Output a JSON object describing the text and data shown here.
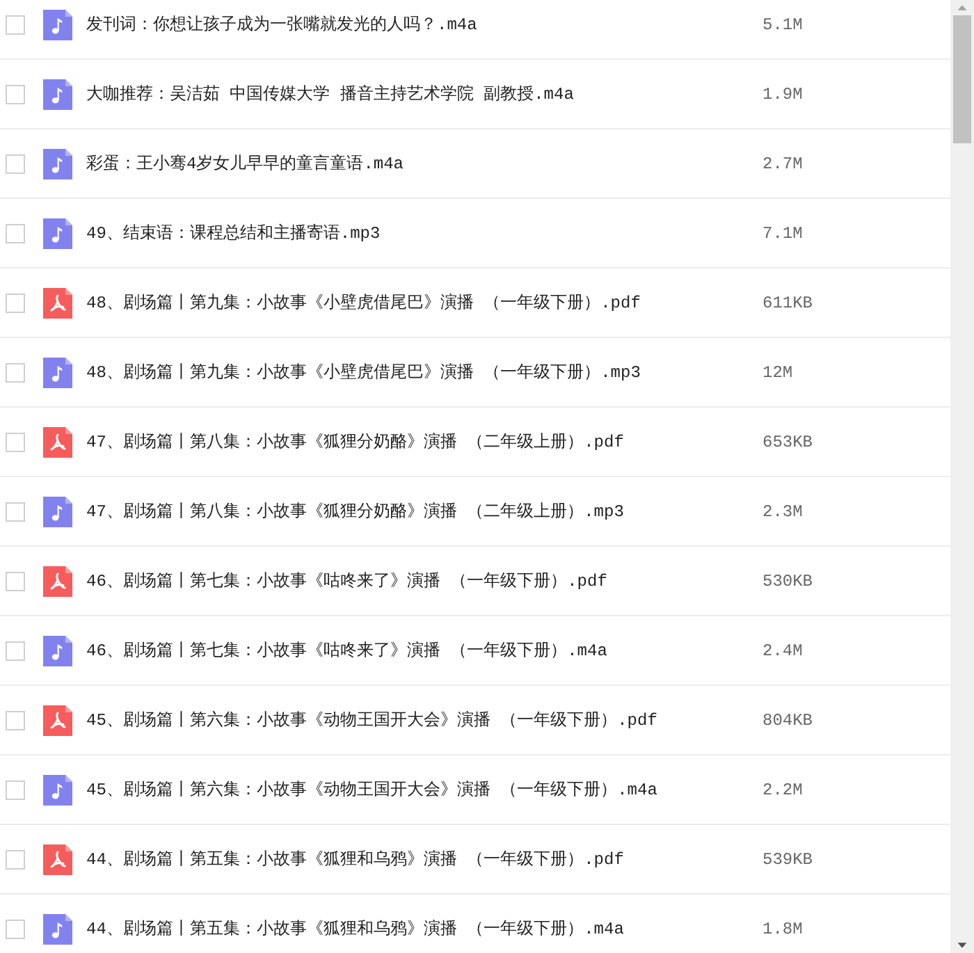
{
  "files": [
    {
      "name": "发刊词：你想让孩子成为一张嘴就发光的人吗？.m4a",
      "size": "5.1M",
      "kind": "audio",
      "checked": false
    },
    {
      "name": "大咖推荐：吴洁茹 中国传媒大学 播音主持艺术学院 副教授.m4a",
      "size": "1.9M",
      "kind": "audio",
      "checked": false
    },
    {
      "name": "彩蛋：王小骞4岁女儿早早的童言童语.m4a",
      "size": "2.7M",
      "kind": "audio",
      "checked": false
    },
    {
      "name": "49、结束语：课程总结和主播寄语.mp3",
      "size": "7.1M",
      "kind": "audio",
      "checked": false
    },
    {
      "name": "48、剧场篇丨第九集：小故事《小壁虎借尾巴》演播 （一年级下册）.pdf",
      "size": "611KB",
      "kind": "pdf",
      "checked": false
    },
    {
      "name": "48、剧场篇丨第九集：小故事《小壁虎借尾巴》演播 （一年级下册）.mp3",
      "size": "12M",
      "kind": "audio",
      "checked": false
    },
    {
      "name": "47、剧场篇丨第八集：小故事《狐狸分奶酪》演播 （二年级上册）.pdf",
      "size": "653KB",
      "kind": "pdf",
      "checked": false
    },
    {
      "name": "47、剧场篇丨第八集：小故事《狐狸分奶酪》演播 （二年级上册）.mp3",
      "size": "2.3M",
      "kind": "audio",
      "checked": false
    },
    {
      "name": "46、剧场篇丨第七集：小故事《咕咚来了》演播 （一年级下册）.pdf",
      "size": "530KB",
      "kind": "pdf",
      "checked": false
    },
    {
      "name": "46、剧场篇丨第七集：小故事《咕咚来了》演播 （一年级下册）.m4a",
      "size": "2.4M",
      "kind": "audio",
      "checked": false
    },
    {
      "name": "45、剧场篇丨第六集：小故事《动物王国开大会》演播 （一年级下册）.pdf",
      "size": "804KB",
      "kind": "pdf",
      "checked": false
    },
    {
      "name": "45、剧场篇丨第六集：小故事《动物王国开大会》演播 （一年级下册）.m4a",
      "size": "2.2M",
      "kind": "audio",
      "checked": false
    },
    {
      "name": "44、剧场篇丨第五集：小故事《狐狸和乌鸦》演播 （一年级下册）.pdf",
      "size": "539KB",
      "kind": "pdf",
      "checked": false
    },
    {
      "name": "44、剧场篇丨第五集：小故事《狐狸和乌鸦》演播 （一年级下册）.m4a",
      "size": "1.8M",
      "kind": "audio",
      "checked": false
    }
  ]
}
